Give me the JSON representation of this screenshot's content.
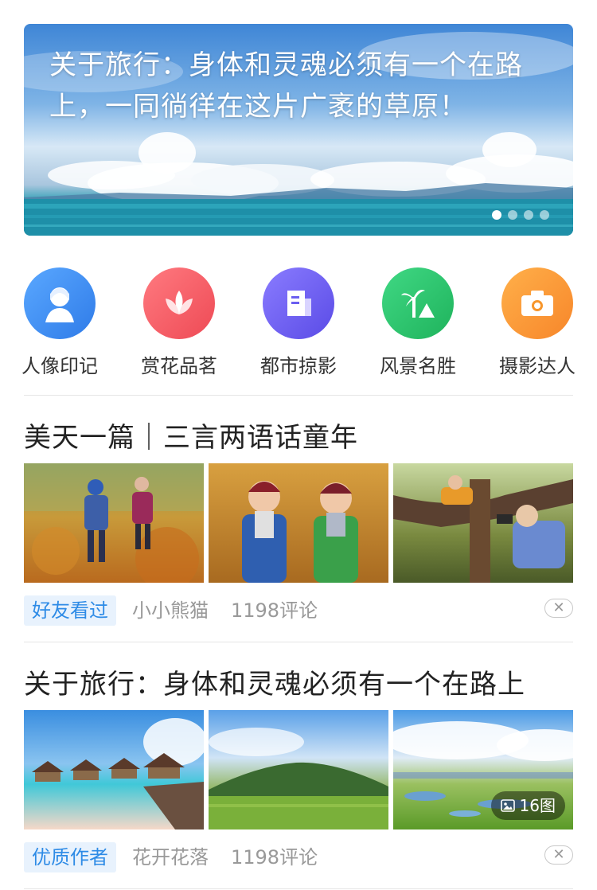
{
  "banner": {
    "title": "关于旅行：身体和灵魂必须有一个在路上，一同徜徉在这片广袤的草原！",
    "dots_count": 4,
    "active_dot": 0
  },
  "categories": [
    {
      "label": "人像印记",
      "icon": "portrait-icon",
      "color": "#3a8ef0"
    },
    {
      "label": "赏花品茗",
      "icon": "lotus-icon",
      "color": "#f0555e"
    },
    {
      "label": "都市掠影",
      "icon": "building-icon",
      "color": "#6a5ef0"
    },
    {
      "label": "风景名胜",
      "icon": "palm-tree-icon",
      "color": "#2bc46b"
    },
    {
      "label": "摄影达人",
      "icon": "camera-icon",
      "color": "#f7962c"
    }
  ],
  "feed": [
    {
      "title": "美天一篇｜三言两语话童年",
      "tag": "好友看过",
      "author": "小小熊猫",
      "comments": "1198评论",
      "images": [
        "children-autumn-leaves",
        "two-boys-backpacks",
        "boys-climbing-tree"
      ]
    },
    {
      "title": "关于旅行：身体和灵魂必须有一个在路上",
      "tag": "优质作者",
      "author": "花开花落",
      "comments": "1198评论",
      "image_count": "16图",
      "images": [
        "overwater-bungalows",
        "green-mountain-field",
        "grassland-wetland"
      ]
    }
  ],
  "colors": {
    "accent": "#2e8be6",
    "tag_bg": "#e8f2fd",
    "muted_text": "#999999"
  }
}
